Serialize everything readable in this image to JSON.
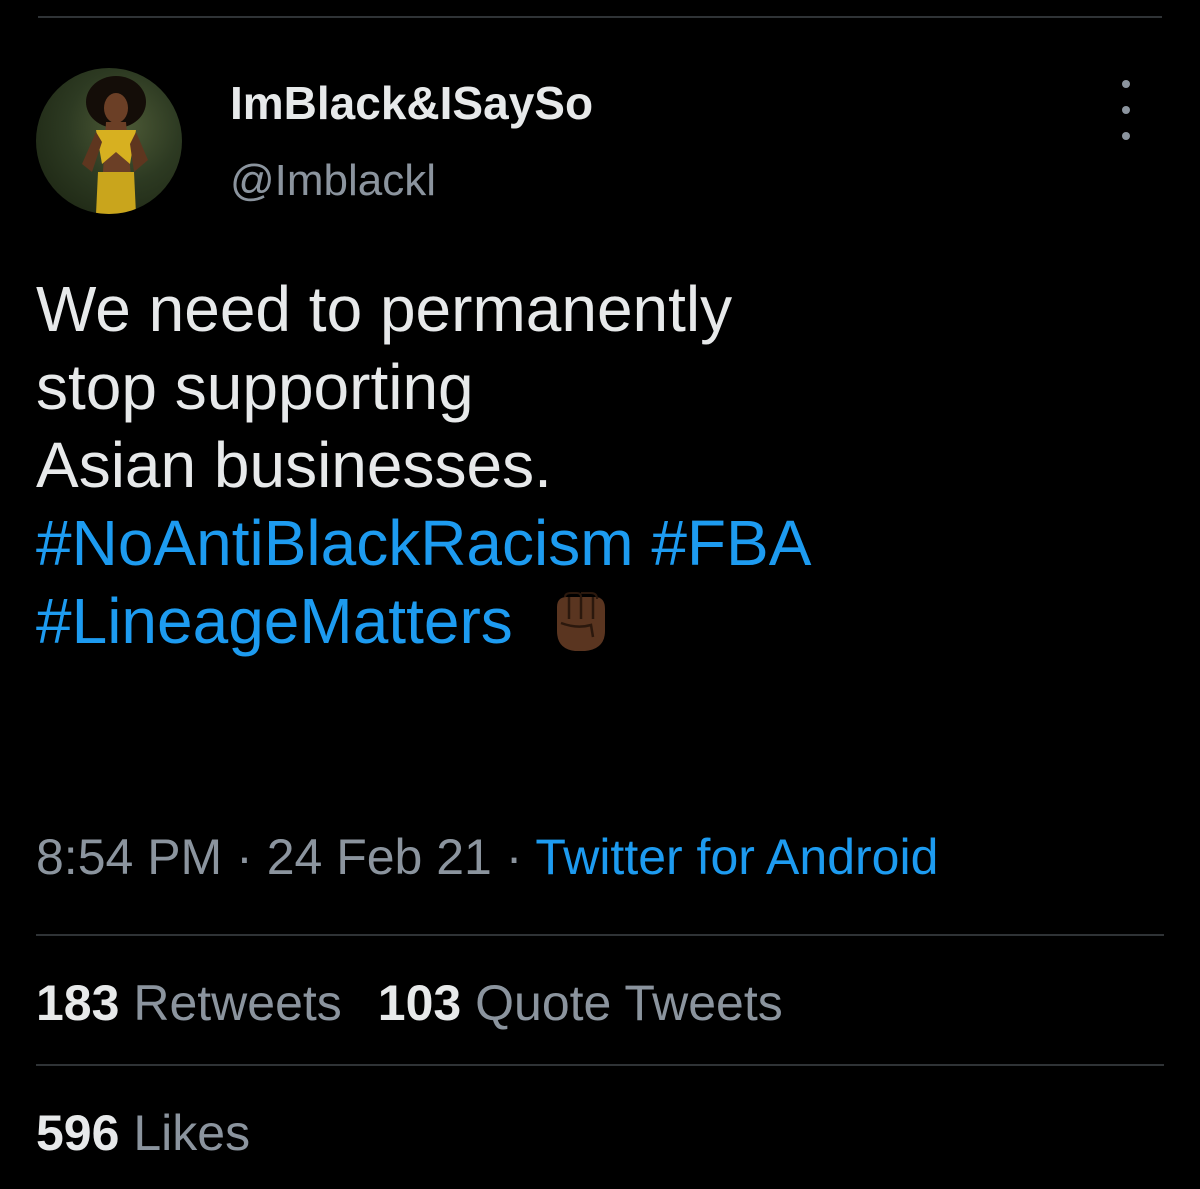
{
  "tweet": {
    "display_name": "ImBlack&ISaySo",
    "handle": "@Imblackl",
    "text_lines": [
      "We need to permanently",
      "stop supporting",
      "Asian businesses."
    ],
    "hashtags": [
      "#NoAntiBlackRacism",
      "#FBA",
      "#LineageMatters"
    ],
    "emoji": "raised-fist-dark-skin-tone",
    "time": "8:54 PM",
    "separator": "·",
    "date": "24 Feb 21",
    "source": "Twitter for Android"
  },
  "stats": {
    "retweets_count": "183",
    "retweets_label": "Retweets",
    "quotes_count": "103",
    "quotes_label": "Quote Tweets",
    "likes_count": "596",
    "likes_label": "Likes"
  },
  "icons": {
    "more": "more-vertical-icon",
    "avatar": "profile-avatar"
  },
  "colors": {
    "background": "#000000",
    "primary_text": "#e7e9ea",
    "secondary_text": "#8b949e",
    "link": "#1d9bf0",
    "divider": "#2f3336"
  }
}
